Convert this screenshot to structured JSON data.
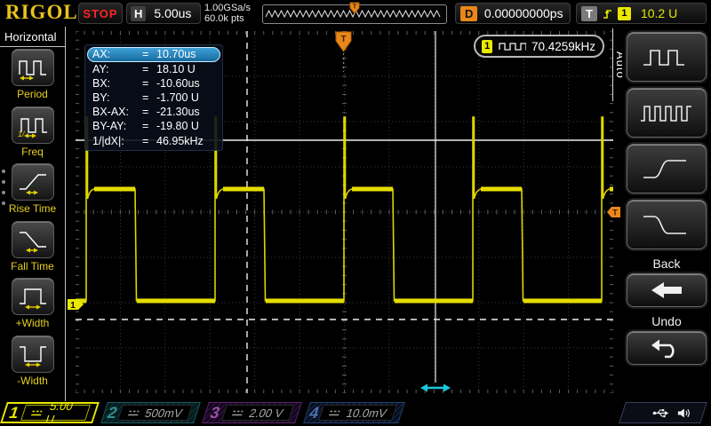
{
  "brand": "RIGOL",
  "colors": {
    "accent_yellow": "#e8e800",
    "trigger_orange": "#e8871a",
    "cursor_cyan": "#18c8dc",
    "selected_row_blue": "#1b7fb4",
    "stop_red": "#ff2424"
  },
  "top_bar": {
    "run_state": "STOP",
    "horizontal_label": "H",
    "timebase": "5.00us",
    "sample_rate": "1.00GSa/s",
    "memory_depth": "60.0k pts",
    "delay_label": "D",
    "delay_value": "0.00000000ps",
    "trigger_label": "T",
    "trigger_source_channel": "1",
    "trigger_level": "10.2 U"
  },
  "left_menu": {
    "title": "Horizontal",
    "items": [
      {
        "label": "Period",
        "icon": "period-icon"
      },
      {
        "label": "Freq",
        "icon": "freq-icon"
      },
      {
        "label": "Rise Time",
        "icon": "rise-time-icon"
      },
      {
        "label": "Fall Time",
        "icon": "fall-time-icon"
      },
      {
        "label": "+Width",
        "icon": "plus-width-icon"
      },
      {
        "label": "-Width",
        "icon": "minus-width-icon"
      }
    ]
  },
  "cursor_panel": {
    "rows": [
      {
        "label": "AX:",
        "eq": "=",
        "value": "10.70us",
        "selected": true
      },
      {
        "label": "AY:",
        "eq": "=",
        "value": "18.10 U",
        "selected": false
      },
      {
        "label": "BX:",
        "eq": "=",
        "value": "-10.60us",
        "selected": false
      },
      {
        "label": "BY:",
        "eq": "=",
        "value": "-1.700 U",
        "selected": false
      },
      {
        "label": "BX-AX:",
        "eq": "=",
        "value": "-21.30us",
        "selected": false
      },
      {
        "label": "BY-AY:",
        "eq": "=",
        "value": "-19.80 U",
        "selected": false
      },
      {
        "label": "1/|dX|:",
        "eq": "=",
        "value": "46.95kHz",
        "selected": false
      }
    ]
  },
  "frequency_readout": {
    "channel": "1",
    "value": "70.4259kHz",
    "icon": "square-wave-icon"
  },
  "right_menu": {
    "tab_label": "Auto",
    "buttons": [
      {
        "icon": "square-wave-icon"
      },
      {
        "icon": "multi-pulse-icon"
      },
      {
        "icon": "rising-edge-icon"
      },
      {
        "icon": "falling-edge-icon"
      }
    ],
    "back_label": "Back",
    "undo_label": "Undo"
  },
  "channels": [
    {
      "number": "1",
      "scale": "5.00 U",
      "active": true,
      "color": "#e8e800"
    },
    {
      "number": "2",
      "scale": "500mV",
      "active": false,
      "color": "#2f8f8f"
    },
    {
      "number": "3",
      "scale": "2.00 V",
      "active": false,
      "color": "#9a4fa0"
    },
    {
      "number": "4",
      "scale": "10.0mV",
      "active": false,
      "color": "#5070b0"
    }
  ],
  "status_icons": [
    "usb-icon",
    "sound-icon"
  ],
  "waveform": {
    "channel": "1",
    "shape": "pulse train with leading spike",
    "measured_frequency": "70.4259kHz"
  }
}
